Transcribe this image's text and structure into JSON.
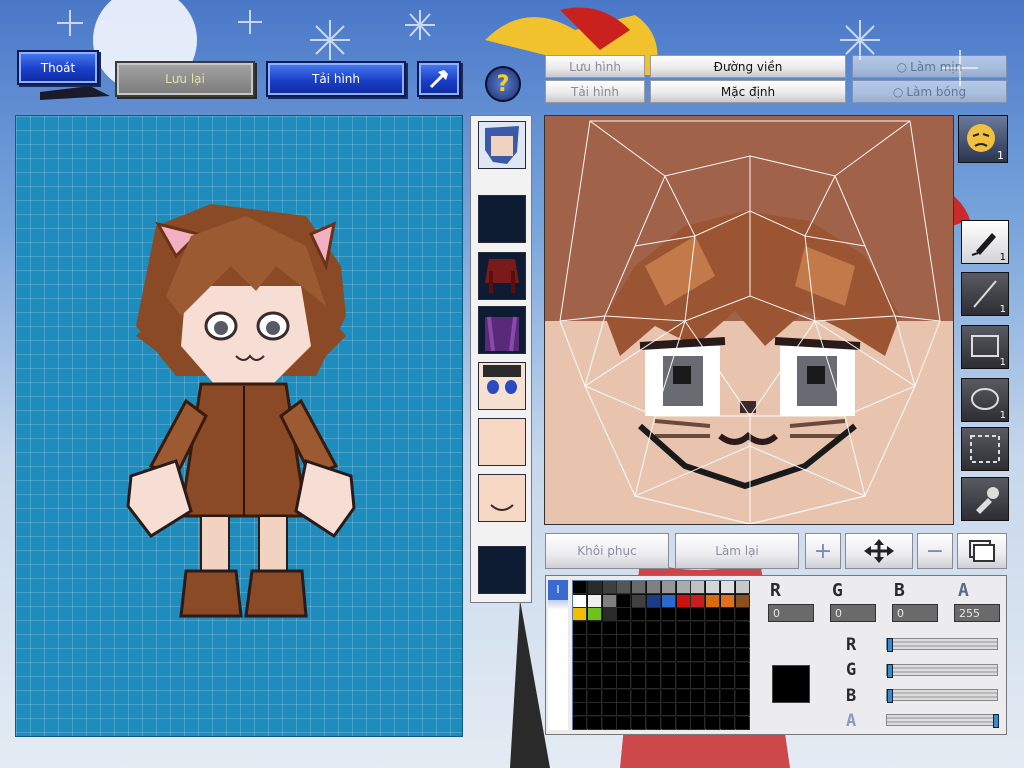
{
  "toolbar": {
    "exit_label": "Thoát",
    "save_label": "Lưu lại",
    "reload_label": "Tải hình",
    "hammer_icon": "hammer-icon",
    "help_icon": "question-mark-icon"
  },
  "tabs": {
    "save_image": "Lưu hình",
    "outline": "Đường viền",
    "smooth": "Làm mịn",
    "load_image": "Tải hình",
    "default": "Mặc định",
    "shading": "Làm bóng"
  },
  "parts": [
    "face-preview",
    "empty-slot",
    "hair-red",
    "outfit-purple",
    "eyes-blue",
    "skin-face",
    "chin-face",
    "empty-slot"
  ],
  "tools": [
    {
      "name": "pen-tool-icon",
      "count": "1",
      "selected": true
    },
    {
      "name": "line-tool-icon",
      "count": "1",
      "selected": false
    },
    {
      "name": "rectangle-tool-icon",
      "count": "1",
      "selected": false
    },
    {
      "name": "ellipse-tool-icon",
      "count": "1",
      "selected": false
    },
    {
      "name": "selection-tool-icon",
      "count": "",
      "selected": false
    },
    {
      "name": "eyedropper-tool-icon",
      "count": "",
      "selected": false
    }
  ],
  "face_badge_count": "1",
  "actions": {
    "restore": "Khôi phục",
    "redo": "Làm lại",
    "plus": "+",
    "minus": "−"
  },
  "color": {
    "r_label": "R",
    "g_label": "G",
    "b_label": "B",
    "a_label": "A",
    "r_value": "0",
    "g_value": "0",
    "b_value": "0",
    "a_value": "255",
    "current": "#000000",
    "sliders": {
      "r": 0.0,
      "g": 0.0,
      "b": 0.0,
      "a": 1.0
    }
  },
  "palette": [
    "#000000",
    "#2a2a2a",
    "#3f3f3f",
    "#555555",
    "#6a6a6a",
    "#808080",
    "#969696",
    "#ababab",
    "#c0c0c0",
    "#d5d5d5",
    "#e0e0e0",
    "#c8c8c8",
    "#ffffff",
    "#f0f0f0",
    "#808080",
    "#000000",
    "#404040",
    "#1a3d8a",
    "#2a6acc",
    "#d01010",
    "#c81e1e",
    "#d86a10",
    "#e07020",
    "#8a5020",
    "#f0c000",
    "#70c020",
    "#2a2a2a"
  ],
  "colors": {
    "preview_bg": "#1e8cbc",
    "editor_top": "#a1624a",
    "editor_bottom": "#e8c4ae"
  }
}
